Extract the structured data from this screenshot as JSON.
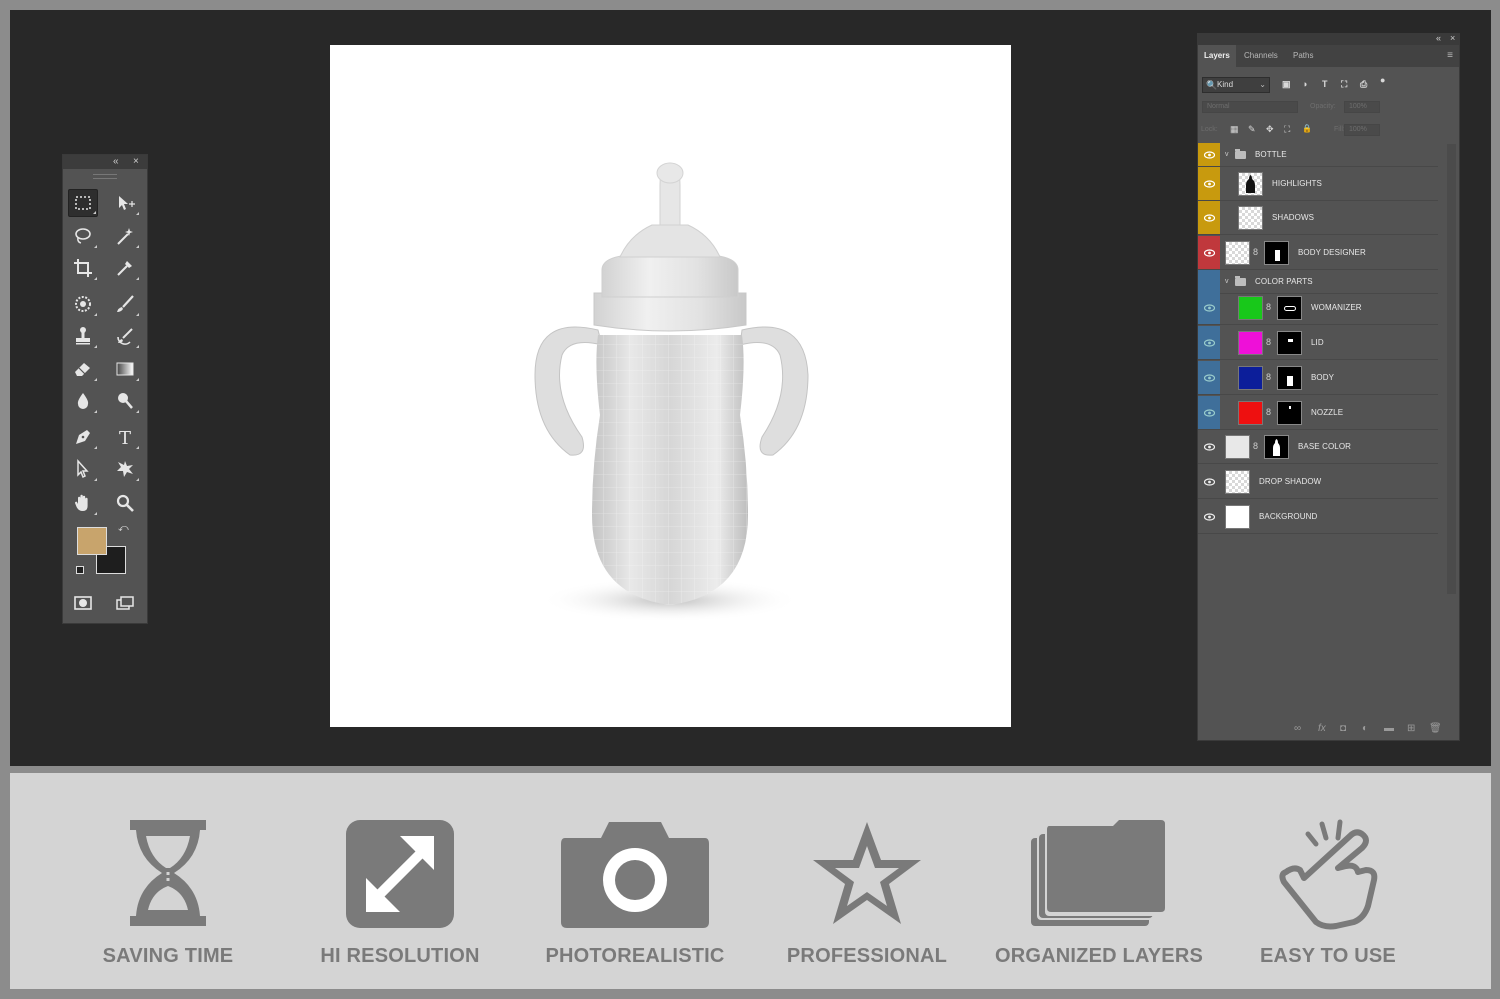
{
  "tools_panel": {
    "collapse_label": "«",
    "close_label": "×",
    "foreground_color": "#c8a46c",
    "background_color": "#1e1e1e"
  },
  "layers_panel": {
    "collapse_label": "«",
    "close_label": "×",
    "menu_label": "≡",
    "tabs": [
      {
        "label": "Layers",
        "active": true
      },
      {
        "label": "Channels",
        "active": false
      },
      {
        "label": "Paths",
        "active": false
      }
    ],
    "filter": {
      "kind_label": "Kind",
      "search_icon": "🔍",
      "dropdown": "⌄",
      "filter_icons": [
        "▣",
        "◑",
        "T",
        "⛶",
        "⎙",
        "●"
      ]
    },
    "blend_mode": "Normal",
    "opacity_label": "Opacity:",
    "opacity_value": "100%",
    "lock_label": "Lock:",
    "lock_icons": [
      "▦",
      "✎",
      "✥",
      "⛶",
      "🔒"
    ],
    "fill_label": "Fill:",
    "fill_value": "100%",
    "rows": [
      {
        "kind": "group",
        "name": "BOTTLE",
        "eye_bg": "#c89a0e"
      },
      {
        "kind": "layer",
        "name": "HIGHLIGHTS",
        "eye_bg": "#c89a0e"
      },
      {
        "kind": "layer",
        "name": "SHADOWS",
        "eye_bg": "#c89a0e"
      },
      {
        "kind": "layer",
        "name": "BODY DESIGNER",
        "eye_bg": "#c0383c"
      },
      {
        "kind": "group",
        "name": "COLOR PARTS",
        "eye_bg": "#3f6f9a"
      },
      {
        "kind": "layer",
        "name": "WOMANIZER",
        "eye_bg": "#3f6f9a",
        "swatch": "#18c81a"
      },
      {
        "kind": "layer",
        "name": "LID",
        "eye_bg": "#3f6f9a",
        "swatch": "#ee10d8"
      },
      {
        "kind": "layer",
        "name": "BODY",
        "eye_bg": "#3f6f9a",
        "swatch": "#0c1e9a"
      },
      {
        "kind": "layer",
        "name": "NOZZLE",
        "eye_bg": "#3f6f9a",
        "swatch": "#ee1010"
      },
      {
        "kind": "layer",
        "name": "BASE COLOR",
        "eye_bg": "#535353"
      },
      {
        "kind": "layer",
        "name": "DROP SHADOW",
        "eye_bg": "#535353"
      },
      {
        "kind": "layer",
        "name": "BACKGROUND",
        "eye_bg": "#535353"
      }
    ],
    "footer_icons": [
      "∞",
      "fx",
      "◘",
      "◐",
      "▬",
      "⊞",
      "🗑"
    ]
  },
  "features": [
    {
      "label": "SAVING TIME",
      "icon": "hourglass-icon"
    },
    {
      "label": "HI RESOLUTION",
      "icon": "expand-arrows-icon"
    },
    {
      "label": "PHOTOREALISTIC",
      "icon": "camera-icon"
    },
    {
      "label": "PROFESSIONAL",
      "icon": "star-icon"
    },
    {
      "label": "ORGANIZED LAYERS",
      "icon": "stacked-folders-icon"
    },
    {
      "label": "EASY TO USE",
      "icon": "tap-hand-icon"
    }
  ],
  "colors": {
    "workspace_bg": "#282828",
    "panel_bg": "#535353",
    "feature_bar_bg": "#d4d4d4",
    "feature_icon": "#7a7a7a"
  }
}
